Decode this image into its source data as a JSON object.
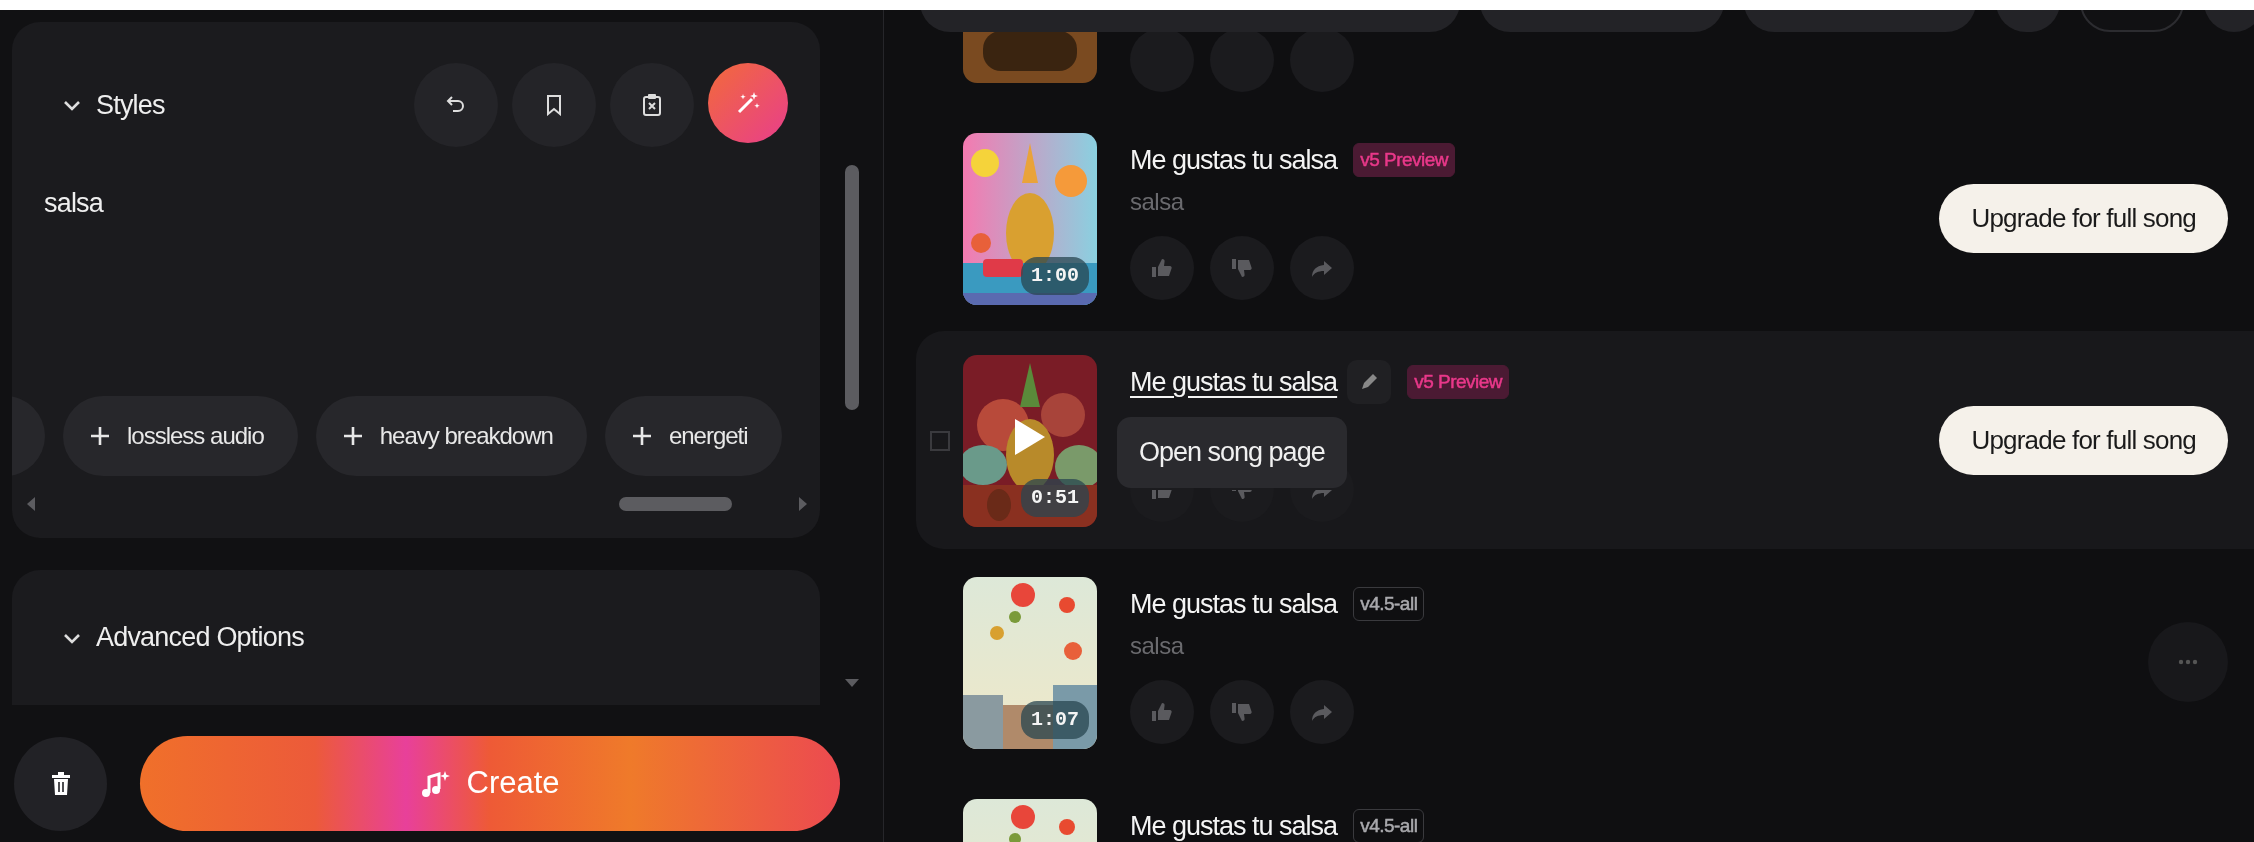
{
  "styles_panel": {
    "title": "Styles",
    "text": "salsa",
    "tags": [
      {
        "label": "lossless audio"
      },
      {
        "label": "heavy breakdown"
      },
      {
        "label": "energeti"
      }
    ]
  },
  "advanced_options": {
    "title": "Advanced Options"
  },
  "create_button": {
    "label": "Create"
  },
  "songs": [
    {
      "title": "Me gustas tu salsa",
      "version": {
        "label": "v5 Preview",
        "color": "#4b1a33"
      },
      "subtitle": "salsa",
      "duration": "1:00",
      "hovered": false,
      "action_label": "Upgrade for full song"
    },
    {
      "title": "Me gustas tu salsa",
      "version": {
        "label": "v5 Preview",
        "color": "#4b1a33"
      },
      "duration": "0:51",
      "hovered": true,
      "checked": false,
      "action_label": "Upgrade for full song",
      "tooltip": "Open song page"
    },
    {
      "title": "Me gustas tu salsa",
      "version": {
        "label": "v4.5-all",
        "color": "#a9a9ad"
      },
      "subtitle": "salsa",
      "duration": "1:07",
      "hovered": false,
      "more_menu": true
    },
    {
      "title": "Me gustas tu salsa",
      "version": {
        "label": "v4.5-all",
        "color": "#a9a9ad"
      },
      "hovered": false
    }
  ]
}
